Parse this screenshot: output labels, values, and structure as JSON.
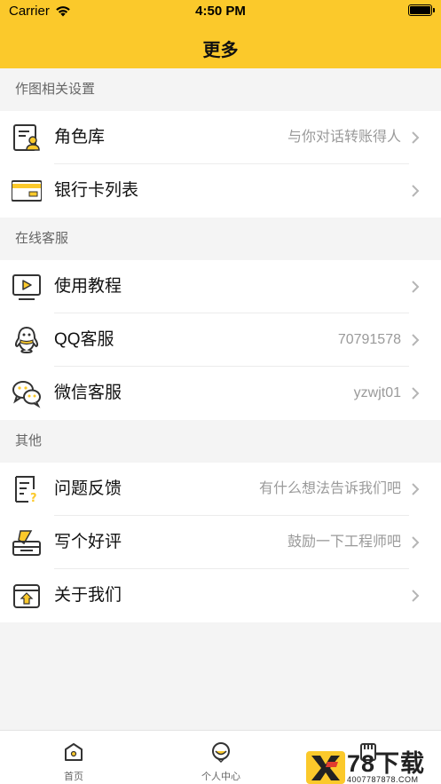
{
  "status_bar": {
    "carrier": "Carrier",
    "time": "4:50 PM"
  },
  "nav": {
    "title": "更多"
  },
  "sections": [
    {
      "title": "作图相关设置",
      "rows": [
        {
          "icon": "role-library-icon",
          "label": "角色库",
          "detail": "与你对话转账得人"
        },
        {
          "icon": "bank-card-icon",
          "label": "银行卡列表",
          "detail": ""
        }
      ]
    },
    {
      "title": "在线客服",
      "rows": [
        {
          "icon": "video-tutorial-icon",
          "label": "使用教程",
          "detail": ""
        },
        {
          "icon": "qq-icon",
          "label": "QQ客服",
          "detail": "70791578"
        },
        {
          "icon": "wechat-icon",
          "label": "微信客服",
          "detail": "yzwjt01"
        }
      ]
    },
    {
      "title": "其他",
      "rows": [
        {
          "icon": "feedback-icon",
          "label": "问题反馈",
          "detail": "有什么想法告诉我们吧"
        },
        {
          "icon": "rate-icon",
          "label": "写个好评",
          "detail": "鼓励一下工程师吧"
        },
        {
          "icon": "about-icon",
          "label": "关于我们",
          "detail": ""
        }
      ]
    }
  ],
  "tabbar": {
    "tabs": [
      {
        "icon": "home-icon",
        "label": "首页"
      },
      {
        "icon": "profile-icon",
        "label": "个人中心"
      },
      {
        "icon": "more-icon",
        "label": ""
      }
    ]
  },
  "watermark": {
    "main": "78下载",
    "sub": "4007787878.COM"
  },
  "colors": {
    "accent": "#fbc92b",
    "background": "#f4f4f4",
    "detail_text": "#9a9a9a"
  }
}
